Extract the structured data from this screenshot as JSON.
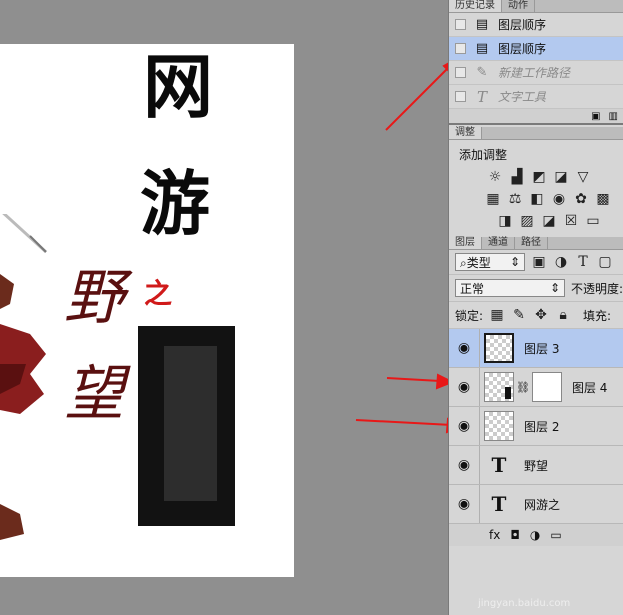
{
  "canvas": {
    "title_chars": [
      "网",
      "游"
    ],
    "small_char": "之",
    "red_chars": [
      "野",
      "望"
    ]
  },
  "history": {
    "tabs": [
      "历史记录",
      "动作"
    ],
    "items": [
      {
        "label": "图层顺序",
        "selected": false,
        "dim": false,
        "icon": "document-icon"
      },
      {
        "label": "图层顺序",
        "selected": true,
        "dim": false,
        "icon": "document-icon"
      },
      {
        "label": "新建工作路径",
        "selected": false,
        "dim": true,
        "icon": "pen-icon"
      },
      {
        "label": "文字工具",
        "selected": false,
        "dim": true,
        "icon": "type-icon"
      }
    ]
  },
  "adjustments": {
    "tab": "调整",
    "title": "添加调整"
  },
  "layers": {
    "tabs": [
      "图层",
      "通道",
      "路径"
    ],
    "filter_kind": "类型",
    "blend_mode": "正常",
    "opacity_label": "不透明度:",
    "lock_label": "锁定:",
    "fill_label": "填充:",
    "items": [
      {
        "name": "图层 3",
        "type": "pixel",
        "selected": true
      },
      {
        "name": "图层 4",
        "type": "pixel-mask",
        "selected": false
      },
      {
        "name": "图层 2",
        "type": "pixel",
        "selected": false
      },
      {
        "name": "野望",
        "type": "text",
        "selected": false
      },
      {
        "name": "网游之",
        "type": "text",
        "selected": false
      }
    ]
  },
  "watermark": "jingyan.baidu.com"
}
